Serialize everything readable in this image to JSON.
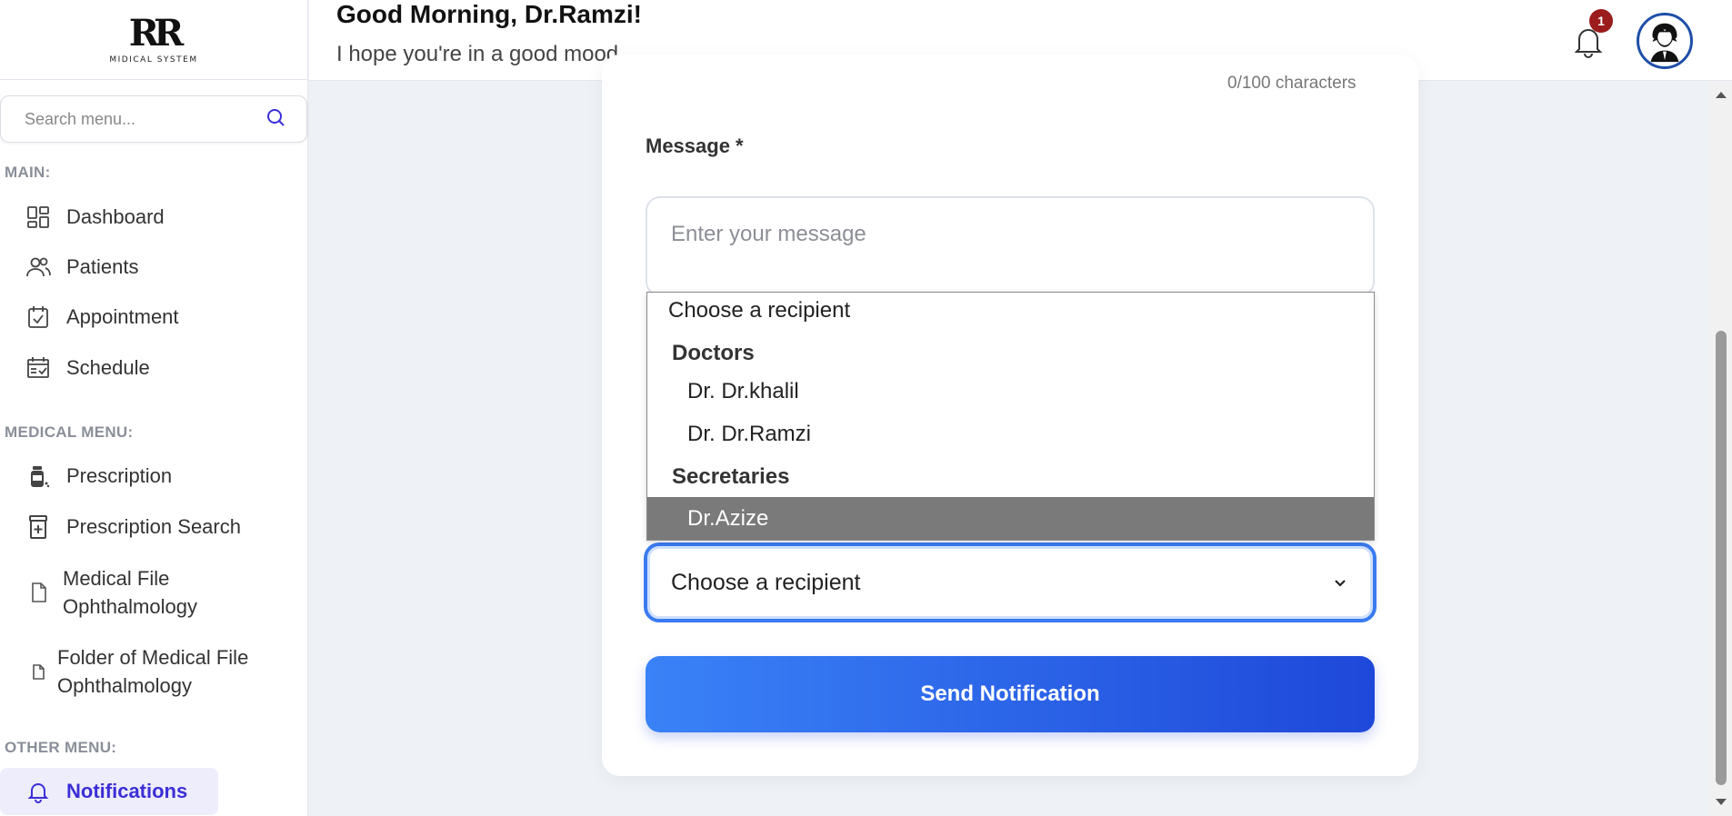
{
  "sidebar": {
    "logo_mark": "RR",
    "logo_sub": "MIDICAL SYSTEM",
    "search_placeholder": "Search menu...",
    "sections": {
      "main": "MAIN:",
      "medical": "MEDICAL MENU:",
      "other": "OTHER MENU:"
    },
    "items": [
      {
        "label": "Dashboard",
        "icon": "dashboard-icon"
      },
      {
        "label": "Patients",
        "icon": "users-icon"
      },
      {
        "label": "Appointment",
        "icon": "calendar-check-icon"
      },
      {
        "label": "Schedule",
        "icon": "schedule-icon"
      },
      {
        "label": "Prescription",
        "icon": "pill-bottle-icon"
      },
      {
        "label": "Prescription Search",
        "icon": "medicine-box-icon"
      },
      {
        "label": "Medical File Ophthalmology",
        "line1": "Medical File",
        "line2": "Ophthalmology",
        "icon": "file-icon"
      },
      {
        "label": "Folder of Medical File Ophthalmology",
        "line1": "Folder of Medical File",
        "line2": "Ophthalmology",
        "icon": "file-icon"
      },
      {
        "label": "Notifications",
        "icon": "bell-icon",
        "active": true
      }
    ]
  },
  "header": {
    "greeting": "Good Morning, Dr.Ramzi!",
    "subtitle": "I hope you're in a good mood",
    "notification_count": "1"
  },
  "form": {
    "char_count": "0/100 characters",
    "message_label": "Message *",
    "message_placeholder": "Enter your message",
    "recipient_value": "Choose a recipient",
    "send_label": "Send Notification"
  },
  "dropdown": {
    "placeholder_option": "Choose a recipient",
    "groups": [
      {
        "label": "Doctors",
        "options": [
          "Dr. Dr.khalil",
          "Dr. Dr.Ramzi"
        ]
      },
      {
        "label": "Secretaries",
        "options": [
          "Dr.Azize"
        ]
      }
    ],
    "highlighted": "Dr.Azize"
  },
  "colors": {
    "accent": "#3a7bf0",
    "active_nav": "#3b2fd6",
    "badge": "#9b1c1c"
  }
}
